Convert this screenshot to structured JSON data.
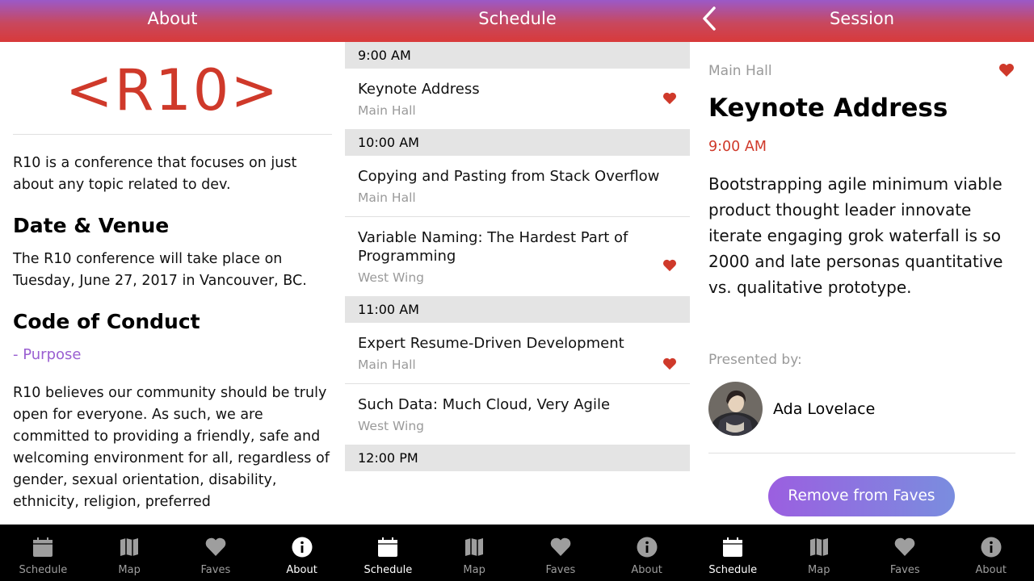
{
  "about": {
    "header_title": "About",
    "logo_text": "<R10>",
    "intro": "R10 is a conference that focuses on just about any topic related to dev.",
    "venue_heading": "Date & Venue",
    "venue_text": "The R10 conference will take place on Tuesday, June 27, 2017 in Vancouver, BC.",
    "conduct_heading": "Code of Conduct",
    "purpose_label": "-  Purpose",
    "conduct_text": "R10 believes our community should be truly open for everyone. As such, we are committed to providing a friendly, safe and welcoming environment for all, regardless of gender, sexual orientation, disability, ethnicity, religion, preferred"
  },
  "schedule": {
    "header_title": "Schedule",
    "blocks": [
      {
        "time": "9:00 AM",
        "sessions": [
          {
            "title": "Keynote Address",
            "location": "Main Hall",
            "faved": true
          }
        ]
      },
      {
        "time": "10:00 AM",
        "sessions": [
          {
            "title": "Copying and Pasting from Stack Overflow",
            "location": "Main Hall",
            "faved": false
          },
          {
            "title": "Variable Naming: The Hardest Part of Programming",
            "location": "West Wing",
            "faved": true
          }
        ]
      },
      {
        "time": "11:00 AM",
        "sessions": [
          {
            "title": "Expert Resume-Driven Development",
            "location": "Main Hall",
            "faved": true
          },
          {
            "title": "Such Data: Much Cloud, Very Agile",
            "location": "West Wing",
            "faved": false
          }
        ]
      },
      {
        "time": "12:00 PM",
        "sessions": []
      }
    ]
  },
  "session": {
    "header_title": "Session",
    "location": "Main Hall",
    "title": "Keynote Address",
    "time": "9:00 AM",
    "description": "Bootstrapping agile minimum viable product thought leader innovate iterate engaging grok waterfall is so 2000 and late personas quantitative vs. qualitative prototype.",
    "presented_by": "Presented by:",
    "speaker": "Ada Lovelace",
    "button_label": "Remove from Faves"
  },
  "tabs": [
    {
      "label": "Schedule",
      "icon": "calendar-icon"
    },
    {
      "label": "Map",
      "icon": "map-icon"
    },
    {
      "label": "Faves",
      "icon": "heart-icon"
    },
    {
      "label": "About",
      "icon": "info-icon"
    }
  ],
  "panel_active_tabs": [
    "About",
    "Schedule",
    "Schedule"
  ],
  "colors": {
    "brand_red": "#cf392a",
    "accent_purple": "#9a5fd1",
    "header_gradient_top": "#9b59c8",
    "header_gradient_bottom": "#d83a3a",
    "tabbar_bg": "#000000"
  }
}
